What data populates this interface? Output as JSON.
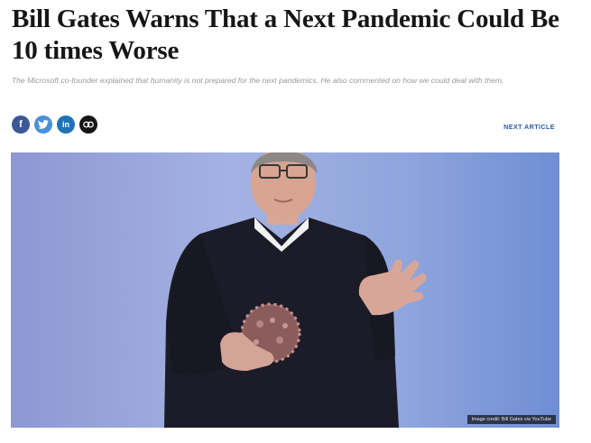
{
  "article": {
    "headline": "Bill Gates Warns That a Next Pandemic Could Be 10 times Worse",
    "subheadline": "The Microsoft co-founder explained that humanity is not prepared for the next pandemics. He also commented on how we could deal with them.",
    "next_article_label": "NEXT ARTICLE",
    "image_credit": "Image credit: Bill Gates via YouTube"
  },
  "share": {
    "facebook_glyph": "f",
    "twitter_glyph": "t",
    "linkedin_glyph": "in",
    "link_glyph": "⛓",
    "icons": [
      "facebook-icon",
      "twitter-icon",
      "linkedin-icon",
      "link-icon"
    ]
  },
  "colors": {
    "facebook": "#3b5998",
    "twitter": "#4a90d9",
    "linkedin": "#1e73b6",
    "link": "#151515",
    "accent": "#2a5aa6"
  }
}
